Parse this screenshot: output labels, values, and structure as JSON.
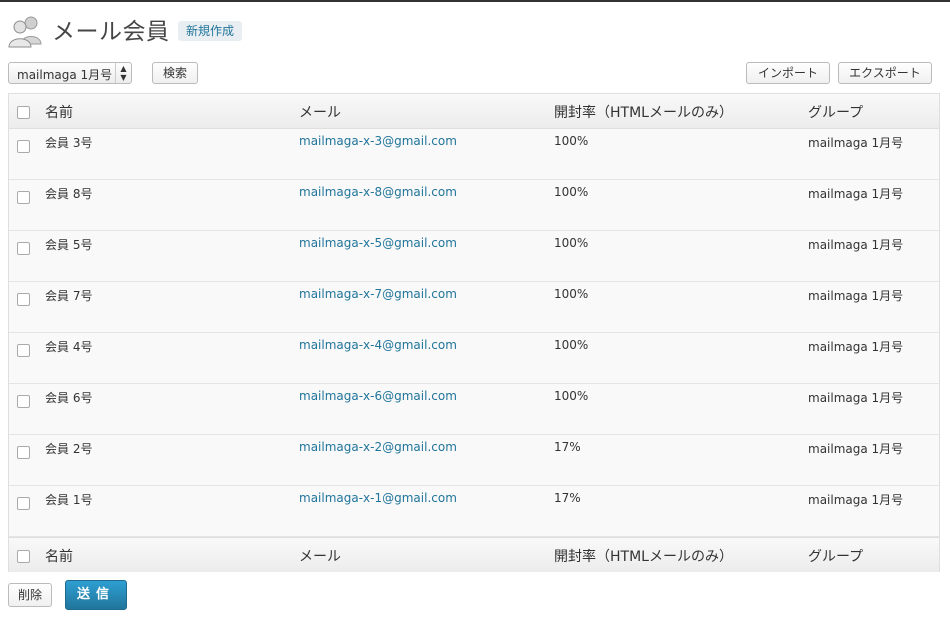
{
  "header": {
    "title": "メール会員",
    "new_button": "新規作成",
    "icon": "users-icon"
  },
  "toolbar": {
    "select_value": "mailmaga 1月号",
    "search_label": "検索",
    "import_label": "インポート",
    "export_label": "エクスポート"
  },
  "table": {
    "columns": [
      "名前",
      "メール",
      "開封率（HTMLメールのみ）",
      "グループ"
    ],
    "rows": [
      {
        "name": "会員 3号",
        "email": "mailmaga-x-3@gmail.com",
        "rate": "100%",
        "group": "mailmaga 1月号"
      },
      {
        "name": "会員 8号",
        "email": "mailmaga-x-8@gmail.com",
        "rate": "100%",
        "group": "mailmaga 1月号"
      },
      {
        "name": "会員 5号",
        "email": "mailmaga-x-5@gmail.com",
        "rate": "100%",
        "group": "mailmaga 1月号"
      },
      {
        "name": "会員 7号",
        "email": "mailmaga-x-7@gmail.com",
        "rate": "100%",
        "group": "mailmaga 1月号"
      },
      {
        "name": "会員 4号",
        "email": "mailmaga-x-4@gmail.com",
        "rate": "100%",
        "group": "mailmaga 1月号"
      },
      {
        "name": "会員 6号",
        "email": "mailmaga-x-6@gmail.com",
        "rate": "100%",
        "group": "mailmaga 1月号"
      },
      {
        "name": "会員 2号",
        "email": "mailmaga-x-2@gmail.com",
        "rate": "17%",
        "group": "mailmaga 1月号"
      },
      {
        "name": "会員 1号",
        "email": "mailmaga-x-1@gmail.com",
        "rate": "17%",
        "group": "mailmaga 1月号"
      }
    ]
  },
  "actions": {
    "delete_label": "削除",
    "send_label": "送信"
  },
  "colors": {
    "link": "#21759b",
    "primary_button": "#21759b"
  }
}
